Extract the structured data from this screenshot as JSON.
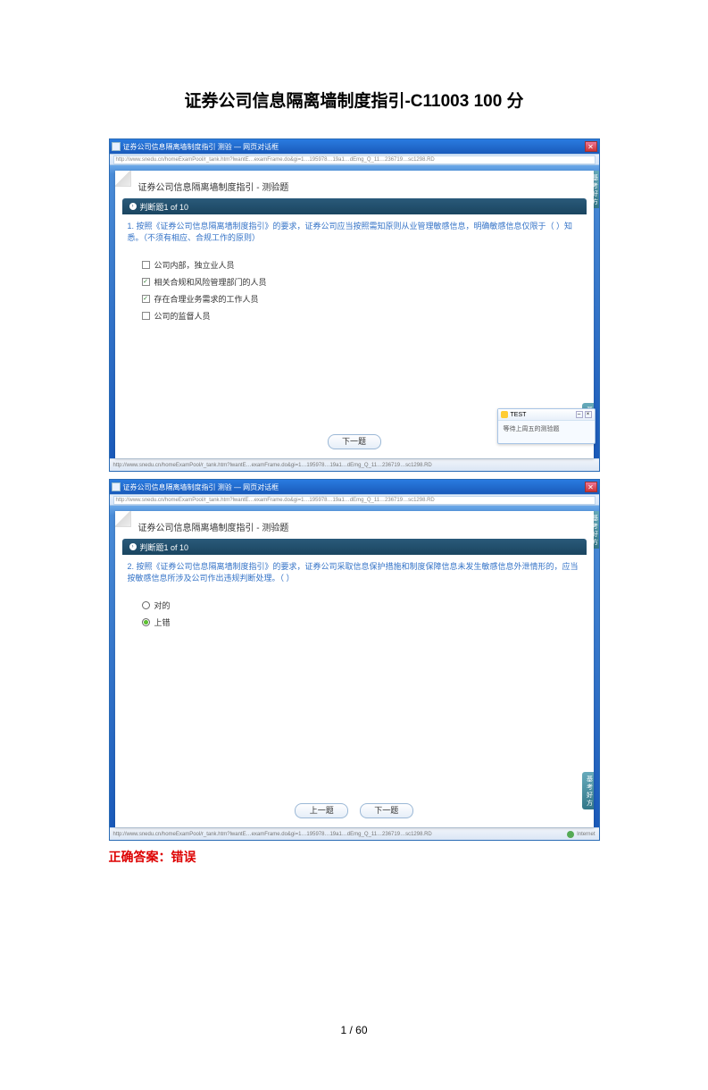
{
  "page": {
    "title": "证券公司信息隔离墙制度指引-C11003   100 分",
    "answer_label": "正确答案：错误",
    "page_num": "1 / 60"
  },
  "screenshot1": {
    "titlebar": "证券公司信息隔离墙制度指引 测验 — 网页对话框",
    "url": "http://www.snedu.cn/homeExamPool/r_tank.htm?lwantE…examFrame.do&gi=1…195978…19a1…dEmg_Q_11…236719…sc1298.RD",
    "paper_title": "证券公司信息隔离墙制度指引 - 测验题",
    "section_label": "判断题1 of 10",
    "question": "1. 按照《证券公司信息隔离墙制度指引》的要求，证券公司应当按照需知原则从业管理敏感信息，明确敏感信息仅限于（  ）知悉。（不须有相应、合规工作的原则）",
    "opts": [
      {
        "checked": false,
        "label": "公司内部，独立业人员"
      },
      {
        "checked": true,
        "label": "相关合规和风险管理部门的人员"
      },
      {
        "checked": true,
        "label": "存在合理业务需求的工作人员"
      },
      {
        "checked": false,
        "label": "公司的监督人员"
      }
    ],
    "next_btn": "下一题",
    "popup_title": "TEST",
    "popup_body": "等待上周五的测验题"
  },
  "screenshot2": {
    "titlebar": "证券公司信息隔离墙制度指引 测验 — 网页对话框",
    "url": "http://www.snedu.cn/homeExamPool/r_tank.htm?lwantE…examFrame.do&gi=1…195978…19a1…dEmg_Q_11…236719…sc1298.RD",
    "paper_title": "证券公司信息隔离墙制度指引 - 测验题",
    "section_label": "判断题1 of 10",
    "question": "2. 按照《证券公司信息隔离墙制度指引》的要求，证券公司采取信息保护措施和制度保障信息未发生敏感信息外泄情形的，应当按敏感信息所涉及公司作出违规判断处理。（ ）",
    "opts": [
      {
        "sel": false,
        "label": "对的"
      },
      {
        "sel": true,
        "label": "上错"
      }
    ],
    "prev_btn": "上一题",
    "next_btn": "下一题",
    "status_right": "Internet"
  }
}
